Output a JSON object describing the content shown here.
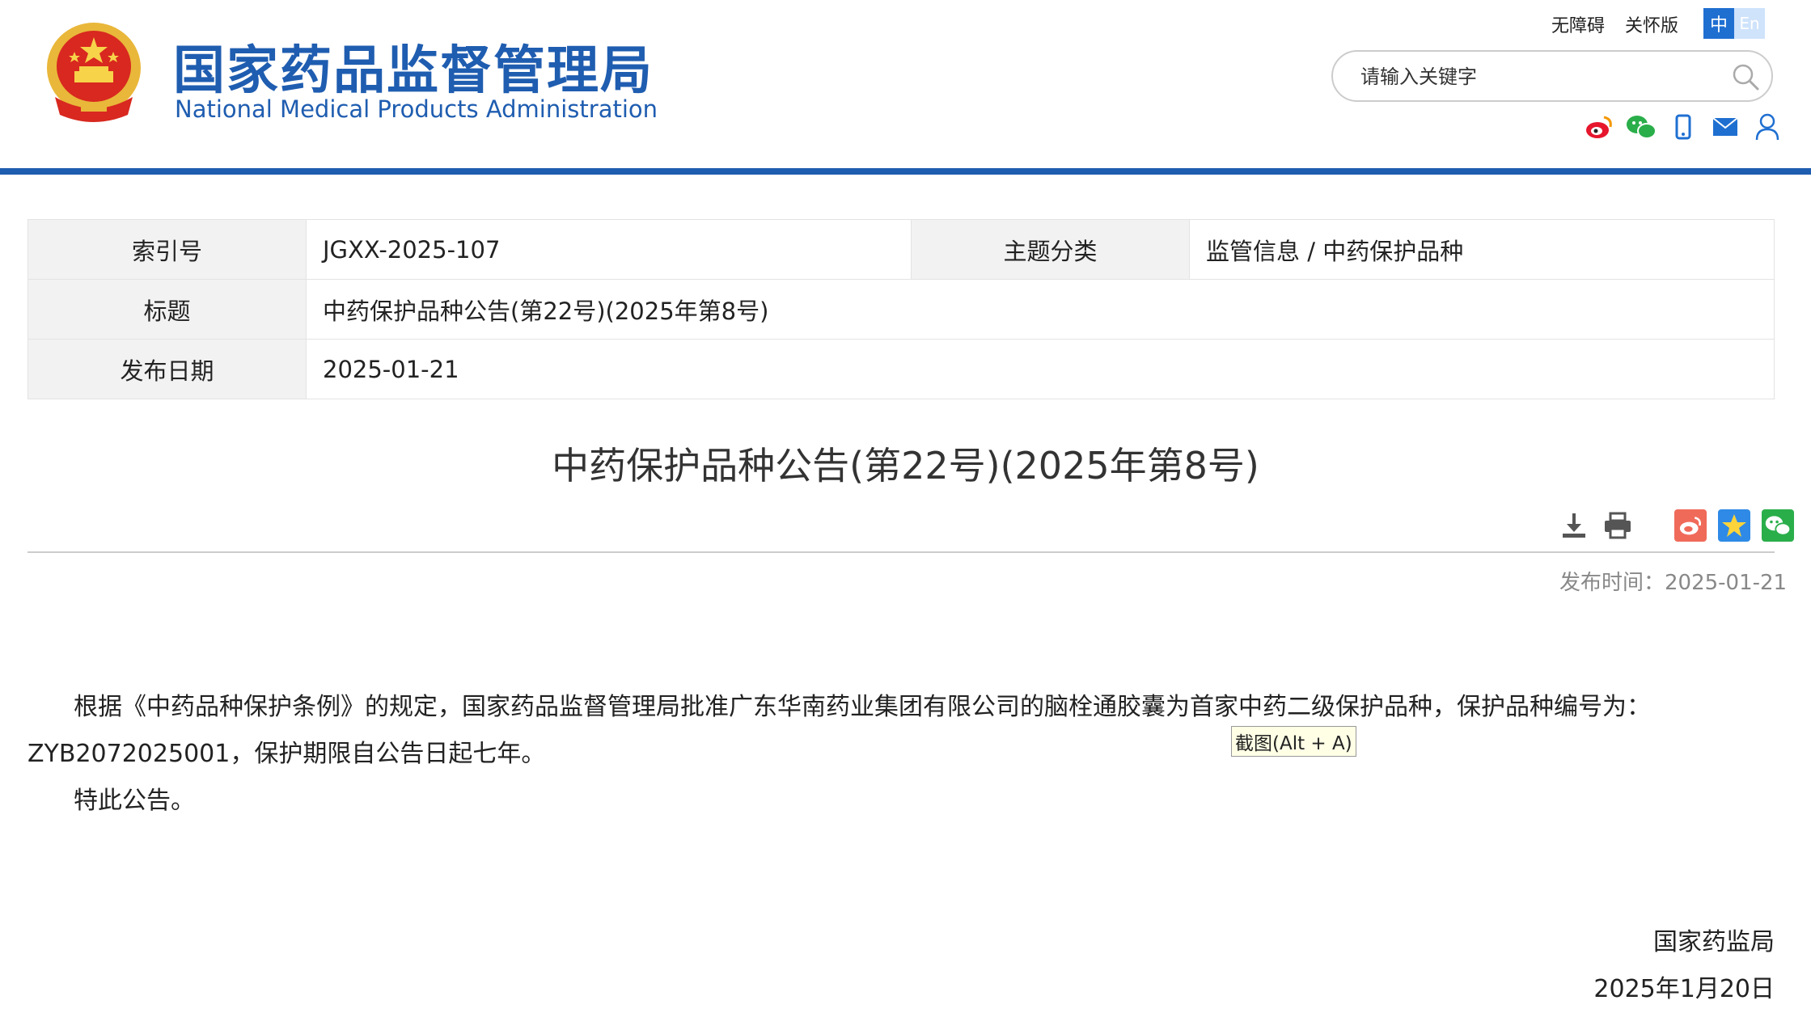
{
  "header": {
    "title": "国家药品监督管理局",
    "subtitle": "National Medical Products Administration",
    "links": [
      "无障碍",
      "关怀版"
    ],
    "lang_zh": "中",
    "lang_en": "En",
    "search_placeholder": "请输入关键字",
    "social_icons": [
      "weibo-icon",
      "wechat-icon",
      "mobile-icon",
      "mail-icon",
      "user-icon"
    ],
    "colors": {
      "brand": "#1f5db0",
      "lang_active": "#1f6fd1",
      "lang_inactive": "#cfe3fb"
    }
  },
  "info": {
    "index_label": "索引号",
    "index_value": "JGXX-2025-107",
    "category_label": "主题分类",
    "category_value": "监管信息 / 中药保护品种",
    "title_label": "标题",
    "title_value": "中药保护品种公告(第22号)(2025年第8号)",
    "date_label": "发布日期",
    "date_value": "2025-01-21"
  },
  "article": {
    "title": "中药保护品种公告(第22号)(2025年第8号)",
    "publish_time": "发布时间：2025-01-21",
    "tools": [
      "download-icon",
      "print-icon",
      "share-weibo-icon",
      "favorite-icon",
      "share-wechat-icon"
    ],
    "paragraph1": "根据《中药品种保护条例》的规定，国家药品监督管理局批准广东华南药业集团有限公司的脑栓通胶囊为首家中药二级保护品种，保护品种编号为：ZYB2072025001，保护期限自公告日起七年。",
    "paragraph2": "特此公告。",
    "signature_org": "国家药监局",
    "signature_date": "2025年1月20日"
  },
  "tooltip": "截图(Alt + A)"
}
